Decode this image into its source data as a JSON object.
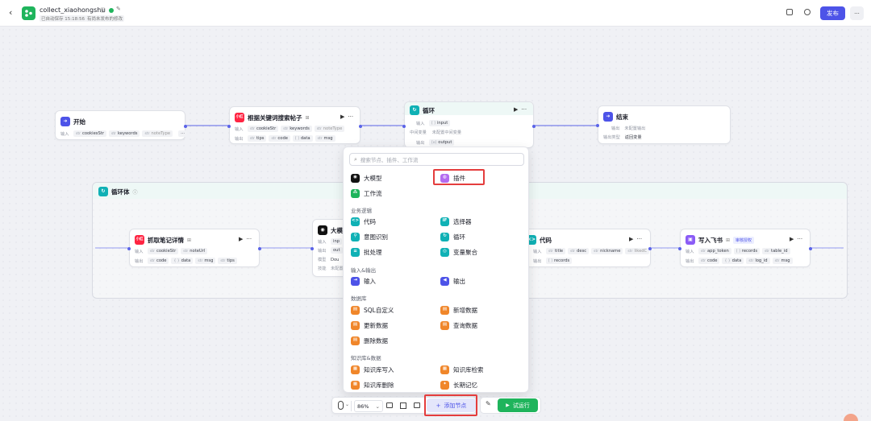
{
  "header": {
    "title": "collect_xiaohongshu",
    "autosave": "已自动保存 15:18:56",
    "unpublished": "有尚未发布的修改",
    "publish_label": "发布"
  },
  "colors": {
    "accent": "#4d53e8",
    "run_green": "#1fb45c",
    "highlight_red": "#e43d3d"
  },
  "nodes": {
    "start": {
      "title": "开始",
      "in_label": "输入",
      "fields": [
        "cookiesStr",
        "keywords",
        "noteType"
      ],
      "more": "···"
    },
    "search": {
      "title": "根据关键词搜索帖子",
      "in_label": "输入",
      "out_label": "输出",
      "inputs": [
        "cookieStr",
        "keywords",
        "noteType"
      ],
      "outputs": [
        "tips",
        "code",
        "data",
        "msg"
      ]
    },
    "loop": {
      "title": "循环",
      "in_label": "输入",
      "mid_label": "中间变量",
      "mid_value": "未配置中间变量",
      "out_label": "输出",
      "input": "input",
      "output": "output"
    },
    "end": {
      "title": "结束",
      "out_label": "输出",
      "out_value": "未配置输出",
      "mode_label": "输出类型",
      "mode_value": "返回变量"
    },
    "loop_body": {
      "title": "循环体"
    },
    "detail": {
      "title": "抓取笔记详情",
      "in_label": "输入",
      "out_label": "输出",
      "inputs": [
        "cookieStr",
        "noteUrl"
      ],
      "outputs": [
        "code",
        "data",
        "msg",
        "tips"
      ]
    },
    "llm": {
      "title": "大模型",
      "in_label": "输入",
      "out_label": "输出",
      "model_label": "模型",
      "model_value": "Dou",
      "skill_label": "技能",
      "skill_value": "未配置",
      "in_value": "inp",
      "out_value": "out"
    },
    "code": {
      "title": "代码",
      "in_label": "输入",
      "out_label": "输出",
      "inputs": [
        "title",
        "desc",
        "nickname",
        "likedC"
      ],
      "outputs": [
        "records"
      ]
    },
    "feishu": {
      "title": "写入飞书",
      "badge": "审核授权",
      "in_label": "输入",
      "out_label": "输出",
      "inputs": [
        "app_token",
        "records",
        "table_id"
      ],
      "outputs": [
        "code",
        "data",
        "log_id",
        "msg"
      ]
    }
  },
  "menu": {
    "search_placeholder": "搜索节点、插件、工作流",
    "llm": "大模型",
    "plugin": "插件",
    "workflow": "工作流",
    "sec_logic": "业务逻辑",
    "code": "代码",
    "selector": "选择器",
    "intent": "意图识别",
    "loop": "循环",
    "batch": "批处理",
    "var_agg": "变量聚合",
    "sec_io": "输入&输出",
    "input": "输入",
    "output": "输出",
    "sec_db": "数据库",
    "sql": "SQL自定义",
    "add_data": "新增数据",
    "update_data": "更新数据",
    "query_data": "查询数据",
    "delete_data": "删除数据",
    "sec_kb": "知识库&数据",
    "kb_write": "知识库写入",
    "kb_search": "知识库检索",
    "kb_delete": "知识库删除",
    "long_memory": "长期记忆"
  },
  "toolbar": {
    "zoom": "86%",
    "add_node": "添加节点",
    "test_run": "试运行"
  }
}
